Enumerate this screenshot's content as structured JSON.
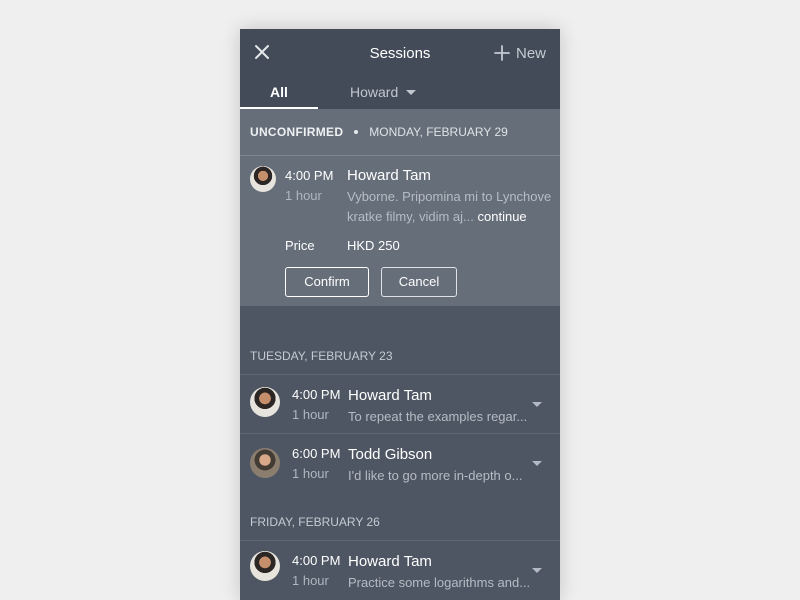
{
  "header": {
    "title": "Sessions",
    "new_label": "New",
    "close_icon": "close-icon",
    "plus_icon": "plus-icon"
  },
  "tabs": {
    "all_label": "All",
    "user_label": "Howard"
  },
  "unconfirmed": {
    "status": "UNCONFIRMED",
    "date": "MONDAY, FEBRUARY 29",
    "time": "4:00 PM",
    "duration": "1 hour",
    "name": "Howard Tam",
    "snippet": "Vyborne. Pripomina mi to Lynchove kratke filmy, vidim aj...",
    "continue_label": "continue",
    "price_label": "Price",
    "price_value": "HKD 250",
    "confirm_label": "Confirm",
    "cancel_label": "Cancel"
  },
  "groups": [
    {
      "date": "TUESDAY, FEBRUARY 23",
      "sessions": [
        {
          "time": "4:00 PM",
          "duration": "1 hour",
          "name": "Howard Tam",
          "snippet": "To repeat the examples regar..."
        },
        {
          "time": "6:00 PM",
          "duration": "1 hour",
          "name": "Todd Gibson",
          "snippet": "I'd like to go more in-depth o..."
        }
      ]
    },
    {
      "date": "FRIDAY, FEBRUARY 26",
      "sessions": [
        {
          "time": "4:00 PM",
          "duration": "1 hour",
          "name": "Howard Tam",
          "snippet": "Practice some logarithms and..."
        }
      ]
    }
  ],
  "colors": {
    "header_bg": "#424b57",
    "panel_bg": "#4d5662",
    "unconfirmed_bg": "#656e79",
    "page_bg": "#efefef"
  }
}
